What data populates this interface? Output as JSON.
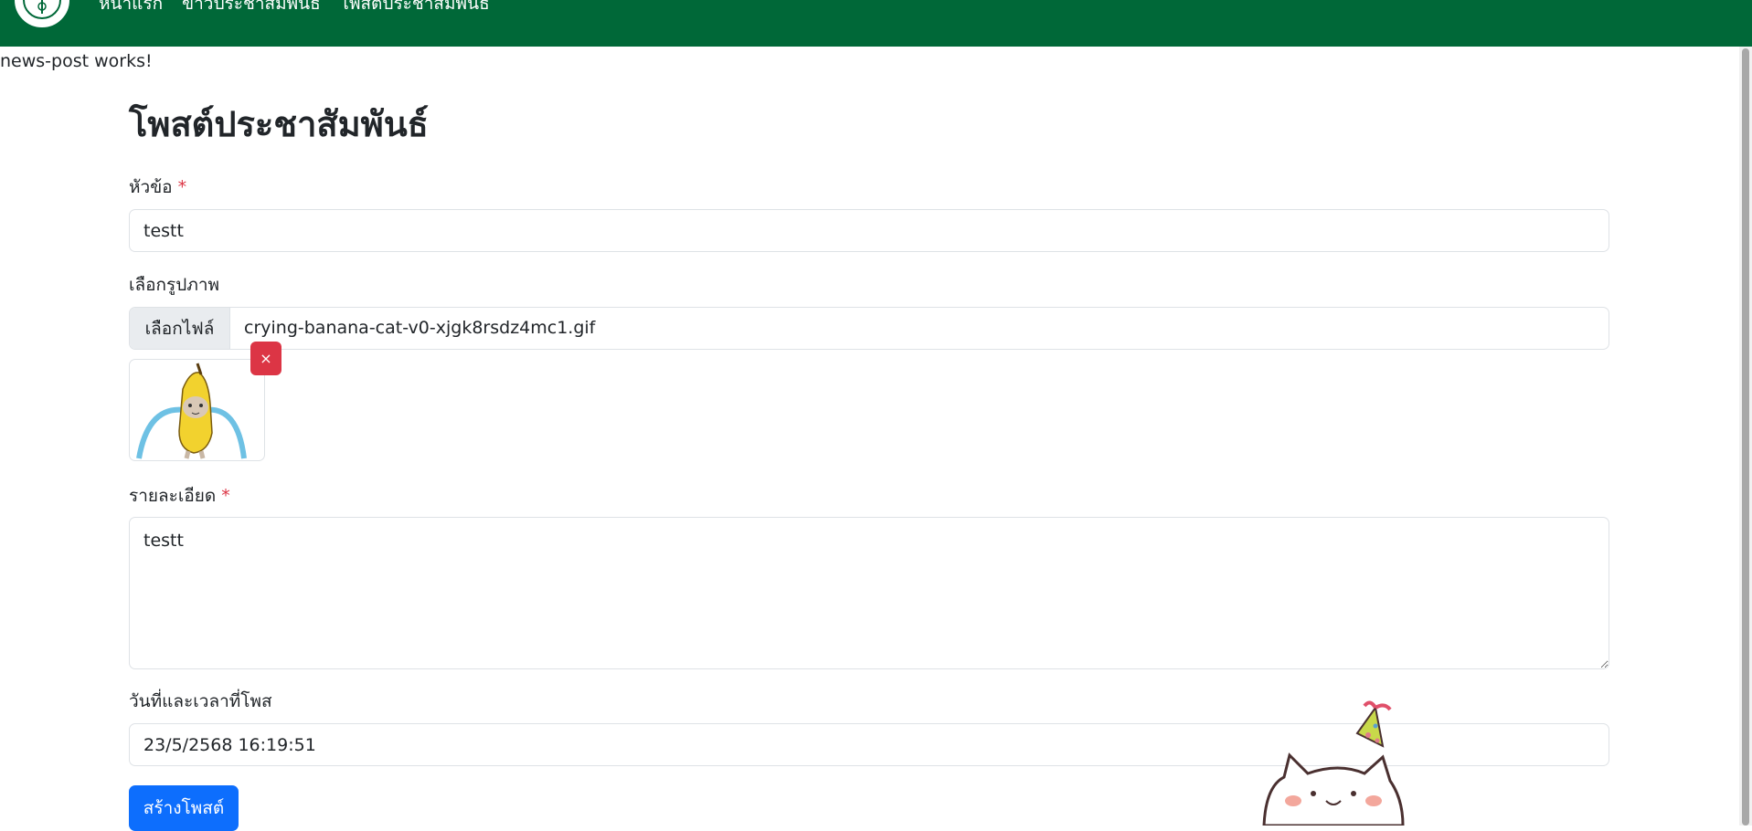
{
  "navbar": {
    "links": [
      {
        "label": "หน้าแรก"
      },
      {
        "label": "ข่าวประชาสัมพันธ์"
      },
      {
        "label": "โพสต์ประชาสัมพันธ์"
      }
    ],
    "color": "#006838"
  },
  "component_status": "news-post works!",
  "form": {
    "title": "โพสต์ประชาสัมพันธ์",
    "required_mark": "*",
    "headline": {
      "label": "หัวข้อ",
      "value": "testt"
    },
    "image": {
      "label": "เลือกรูปภาพ",
      "button_label": "เลือกไฟล์",
      "file_name": "crying-banana-cat-v0-xjgk8rsdz4mc1.gif",
      "remove_label": "×"
    },
    "detail": {
      "label": "รายละเอียด",
      "value": "testt"
    },
    "datetime": {
      "label": "วันที่และเวลาที่โพส",
      "value": "23/5/2568 16:19:51"
    },
    "submit_label": "สร้างโพสต์"
  },
  "colors": {
    "primary": "#0d6efd",
    "danger": "#dc3545"
  }
}
